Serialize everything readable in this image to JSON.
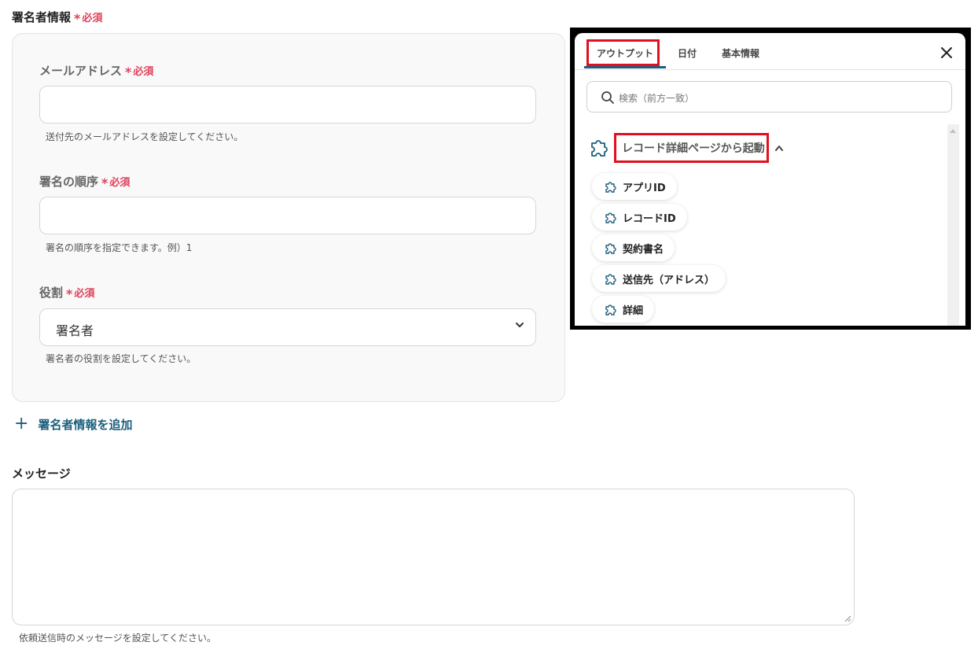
{
  "required_label": "必須",
  "signer_section": {
    "title": "署名者情報",
    "email": {
      "label": "メールアドレス",
      "value": "",
      "help": "送付先のメールアドレスを設定してください。"
    },
    "order": {
      "label": "署名の順序",
      "value": "",
      "help": "署名の順序を指定できます。例）1"
    },
    "role": {
      "label": "役割",
      "selected": "署名者",
      "help": "署名者の役割を設定してください。"
    },
    "add_link": "署名者情報を追加"
  },
  "message_section": {
    "title": "メッセージ",
    "value": "",
    "help": "依頼送信時のメッセージを設定してください。"
  },
  "popup": {
    "tabs": [
      "アウトプット",
      "日付",
      "基本情報"
    ],
    "active_tab": "アウトプット",
    "search_placeholder": "検索（前方一致）",
    "group_title": "レコード詳細ページから起動",
    "items": [
      "アプリID",
      "レコードID",
      "契約書名",
      "送信先（アドレス）",
      "詳細"
    ]
  },
  "colors": {
    "accent": "#1b5f7d",
    "required": "#e0405a",
    "highlight_box": "#e01020"
  },
  "icons": {
    "close": "close-icon",
    "search": "search-icon",
    "plugin": "puzzle-icon",
    "chevron_up": "chevron-up-icon",
    "chevron_down": "chevron-down-icon",
    "plus": "plus-icon"
  }
}
